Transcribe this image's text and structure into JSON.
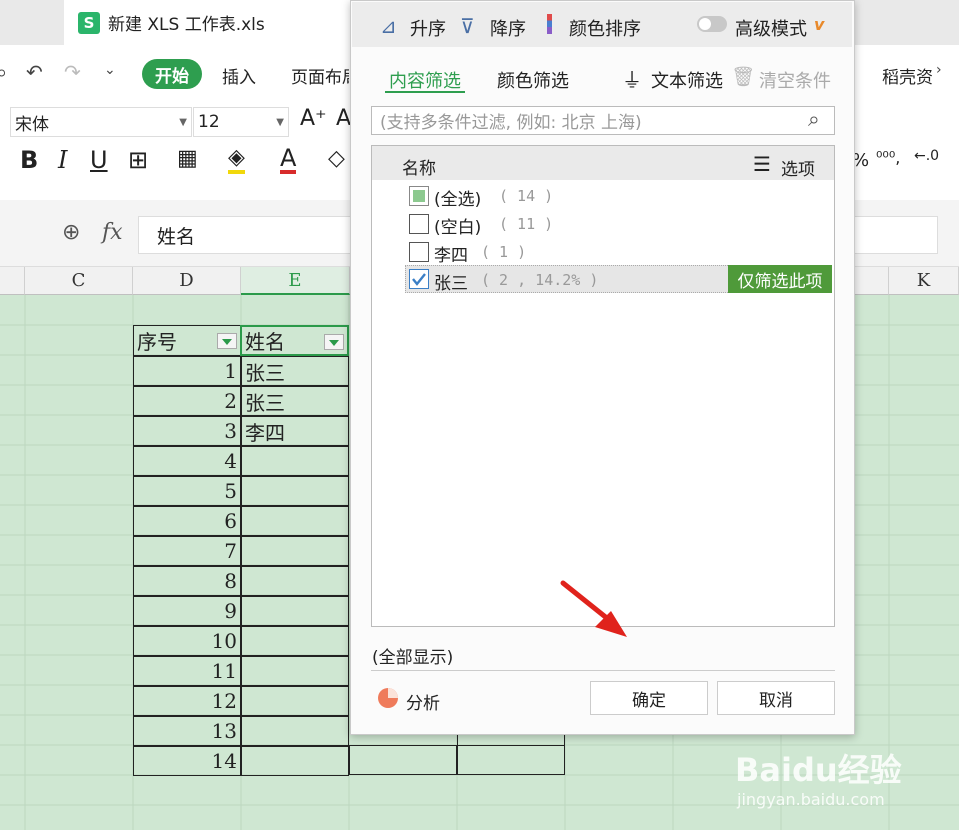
{
  "tab": {
    "icon_letter": "S",
    "title": "新建 XLS 工作表.xls"
  },
  "menu": {
    "start": "开始",
    "insert": "插入",
    "layout": "页面布局",
    "daoke": "稻壳资"
  },
  "font": {
    "family": "宋体",
    "size": "12"
  },
  "formula_bar": {
    "fx": "fx",
    "value": "姓名"
  },
  "columns": [
    "C",
    "D",
    "E",
    "K"
  ],
  "sheet": {
    "header": {
      "seq": "序号",
      "name": "姓名"
    },
    "rows": [
      {
        "num": "1",
        "name": "张三"
      },
      {
        "num": "2",
        "name": "张三"
      },
      {
        "num": "3",
        "name": "李四"
      },
      {
        "num": "4",
        "name": ""
      },
      {
        "num": "5",
        "name": ""
      },
      {
        "num": "6",
        "name": ""
      },
      {
        "num": "7",
        "name": ""
      },
      {
        "num": "8",
        "name": ""
      },
      {
        "num": "9",
        "name": ""
      },
      {
        "num": "10",
        "name": ""
      },
      {
        "num": "11",
        "name": ""
      },
      {
        "num": "12",
        "name": ""
      },
      {
        "num": "13",
        "name": ""
      },
      {
        "num": "14",
        "name": ""
      }
    ]
  },
  "filter_panel": {
    "sort_asc": "升序",
    "sort_desc": "降序",
    "color_sort": "颜色排序",
    "advanced": "高级模式",
    "tab_content": "内容筛选",
    "tab_color": "颜色筛选",
    "text_filter": "文本筛选",
    "clear": "清空条件",
    "search_placeholder": "(支持多条件过滤, 例如: 北京 上海)",
    "list_header": "名称",
    "options": "选项",
    "items": [
      {
        "label": "(全选)",
        "count": "( 14 )",
        "state": "partial"
      },
      {
        "label": "(空白)",
        "count": "( 11 )",
        "state": "unchecked"
      },
      {
        "label": "李四",
        "count": "( 1 )",
        "state": "unchecked"
      },
      {
        "label": "张三",
        "count": "( 2 , 14.2% )",
        "state": "checked"
      }
    ],
    "only_this": "仅筛选此项",
    "show_all": "(全部显示)",
    "analyze": "分析",
    "ok": "确定",
    "cancel": "取消"
  },
  "watermark": {
    "brand": "Baidu经验",
    "url": "jingyan.baidu.com"
  },
  "colors": {
    "accent": "#2e9e4f",
    "arrow": "#e0231c"
  }
}
